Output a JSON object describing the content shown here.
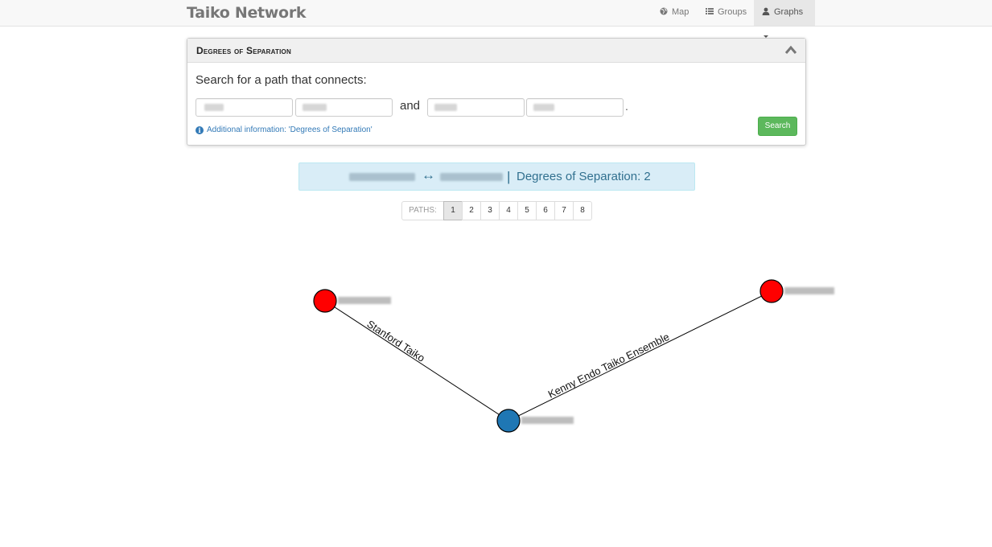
{
  "navbar": {
    "brand": "Taiko Network",
    "items": [
      {
        "label": "Map",
        "icon": "globe-icon"
      },
      {
        "label": "Groups",
        "icon": "list-icon"
      },
      {
        "label": "Graphs",
        "icon": "user-icon",
        "active": true
      }
    ]
  },
  "panel": {
    "title": "Degrees of Separation",
    "prompt": "Search for a path that connects:",
    "and_word": "and",
    "period": ".",
    "info_text": "Additional information: 'Degrees of Separation'",
    "search_label": "Search",
    "search_color": "#5cb85c"
  },
  "result": {
    "arrow": "↔",
    "pipe": "|",
    "degrees_label": "Degrees of Separation: 2"
  },
  "pagination": {
    "label": "PATHS:",
    "pages": [
      "1",
      "2",
      "3",
      "4",
      "5",
      "6",
      "7",
      "8"
    ],
    "active_page": "1"
  },
  "graph": {
    "nodes": [
      {
        "id": "a",
        "color": "#ff0000"
      },
      {
        "id": "b",
        "color": "#ff0000"
      },
      {
        "id": "c",
        "color": "#1f77b4"
      }
    ],
    "edges": [
      {
        "from": "a",
        "to": "c",
        "label": "Stanford Taiko"
      },
      {
        "from": "c",
        "to": "b",
        "label": "Kenny Endo Taiko Ensemble"
      }
    ]
  }
}
